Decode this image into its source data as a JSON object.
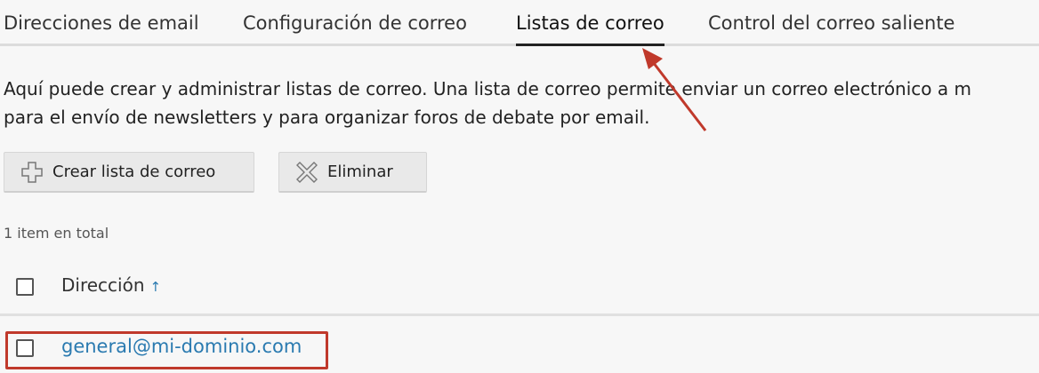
{
  "tabs": [
    {
      "label": "Direcciones de email",
      "active": false
    },
    {
      "label": "Configuración de correo",
      "active": false
    },
    {
      "label": "Listas de correo",
      "active": true
    },
    {
      "label": "Control del correo saliente",
      "active": false
    }
  ],
  "description": {
    "line1": "Aquí puede crear y administrar listas de correo. Una lista de correo permite enviar un correo electrónico a m",
    "line2": "para el envío de newsletters y para organizar foros de debate por email."
  },
  "toolbar": {
    "create_label": "Crear lista de correo",
    "create_icon": "plus-icon",
    "delete_label": "Eliminar",
    "delete_icon": "x-icon"
  },
  "total_text": "1 item en total",
  "table": {
    "header": {
      "column": "Dirección",
      "sort_indicator": "↑"
    },
    "rows": [
      {
        "address": "general@mi-dominio.com"
      }
    ]
  },
  "colors": {
    "link": "#2a7ab0",
    "annotation": "#c0392b",
    "active_tab_underline": "#222222"
  }
}
